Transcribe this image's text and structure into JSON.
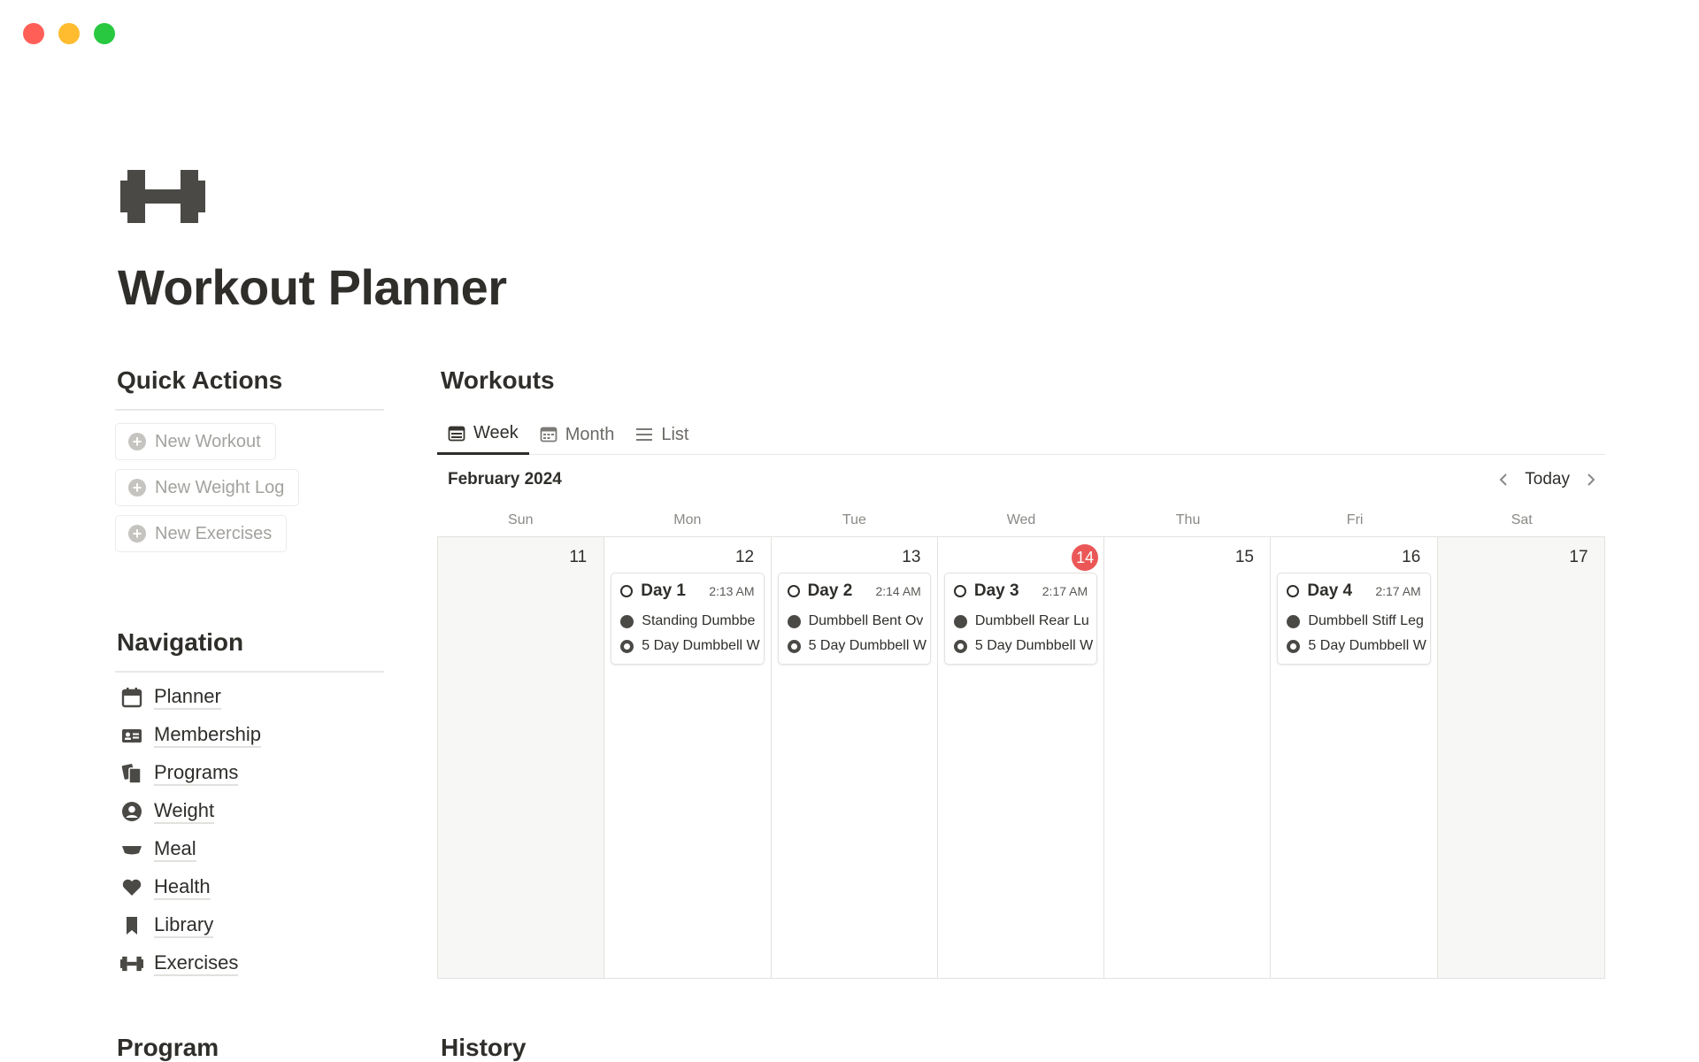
{
  "window": {
    "controls": [
      {
        "name": "close",
        "color": "#ff5f57"
      },
      {
        "name": "minimize",
        "color": "#febc2e"
      },
      {
        "name": "maximize",
        "color": "#28c840"
      }
    ]
  },
  "page": {
    "icon": "dumbbell-icon",
    "title": "Workout Planner"
  },
  "quick_actions": {
    "heading": "Quick Actions",
    "buttons": [
      {
        "label": "New Workout",
        "icon": "plus-circle-icon"
      },
      {
        "label": "New Weight Log",
        "icon": "plus-circle-icon"
      },
      {
        "label": "New Exercises",
        "icon": "plus-circle-icon"
      }
    ]
  },
  "navigation": {
    "heading": "Navigation",
    "items": [
      {
        "label": "Planner",
        "icon": "calendar-icon"
      },
      {
        "label": "Membership",
        "icon": "id-card-icon"
      },
      {
        "label": "Programs",
        "icon": "documents-icon"
      },
      {
        "label": "Weight",
        "icon": "user-circle-icon"
      },
      {
        "label": "Meal",
        "icon": "bowl-icon"
      },
      {
        "label": "Health",
        "icon": "heart-icon"
      },
      {
        "label": "Library",
        "icon": "bookmark-icon"
      },
      {
        "label": "Exercises",
        "icon": "dumbbell-icon"
      }
    ]
  },
  "program_heading": "Program",
  "history_heading": "History",
  "workouts": {
    "heading": "Workouts",
    "tabs": [
      {
        "label": "Week",
        "icon": "calendar-week-icon",
        "active": true
      },
      {
        "label": "Month",
        "icon": "calendar-month-icon",
        "active": false
      },
      {
        "label": "List",
        "icon": "list-icon",
        "active": false
      }
    ],
    "calendar": {
      "month_label": "February 2024",
      "today_label": "Today",
      "weekdays": [
        "Sun",
        "Mon",
        "Tue",
        "Wed",
        "Thu",
        "Fri",
        "Sat"
      ],
      "days": [
        {
          "num": "11",
          "today": false,
          "weekend": true
        },
        {
          "num": "12",
          "today": false,
          "weekend": false
        },
        {
          "num": "13",
          "today": false,
          "weekend": false
        },
        {
          "num": "14",
          "today": true,
          "weekend": false
        },
        {
          "num": "15",
          "today": false,
          "weekend": false
        },
        {
          "num": "16",
          "today": false,
          "weekend": false
        },
        {
          "num": "17",
          "today": false,
          "weekend": true
        }
      ],
      "events": {
        "12": {
          "title": "Day 1",
          "time": "2:13 AM",
          "exercise": "Standing Dumbbe",
          "program": "5 Day Dumbbell W"
        },
        "13": {
          "title": "Day 2",
          "time": "2:14 AM",
          "exercise": "Dumbbell Bent Ov",
          "program": "5 Day Dumbbell W"
        },
        "14": {
          "title": "Day 3",
          "time": "2:17 AM",
          "exercise": "Dumbbell Rear Lu",
          "program": "5 Day Dumbbell W"
        },
        "16": {
          "title": "Day 4",
          "time": "2:17 AM",
          "exercise": "Dumbbell Stiff Leg",
          "program": "5 Day Dumbbell W"
        }
      },
      "today_color": "#eb5757"
    }
  }
}
